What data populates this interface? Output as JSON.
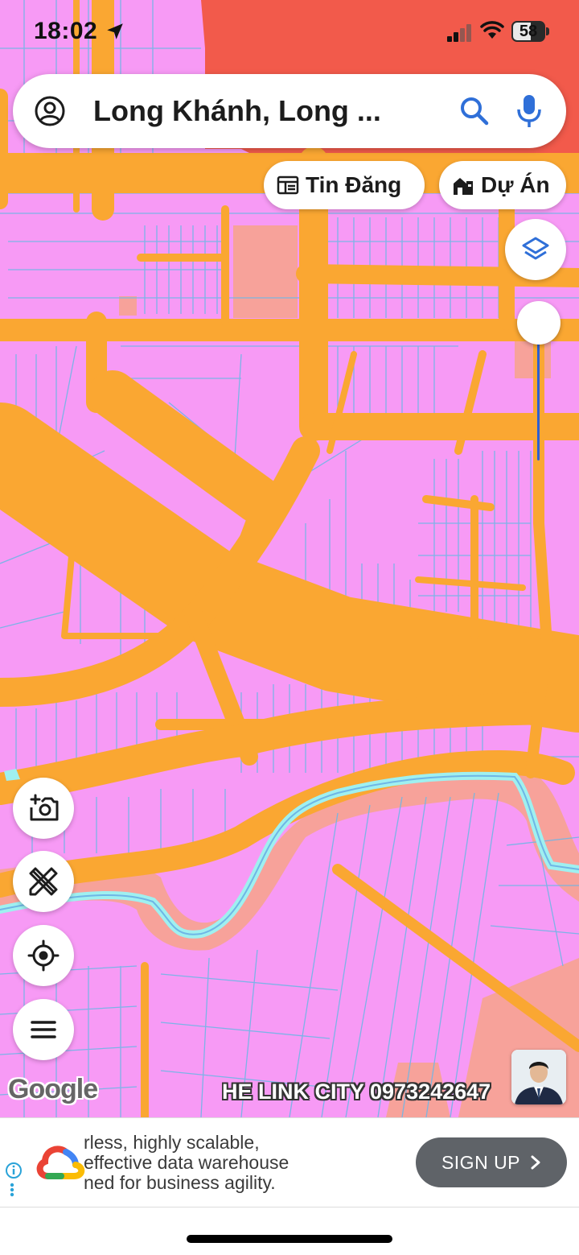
{
  "status_bar": {
    "time": "18:02",
    "battery": "58",
    "battery_level_pct": 58
  },
  "search": {
    "query": "Long Khánh, Long ..."
  },
  "chips": {
    "listings_label": "Tin Đăng",
    "projects_label": "Dự Án"
  },
  "map": {
    "attribution": "Google",
    "marquee": "HE LINK CITY 0973242647",
    "zoom_slider_level": 0.3,
    "colors": {
      "residential": "#f79af5",
      "road": "#faa732",
      "commercial": "#f25a4b",
      "public": "#f7a29a",
      "water": "#9ff0f0",
      "parcel_line": "#6fb6e6"
    }
  },
  "icons": {
    "navigation": "location-arrow-icon",
    "signal": "cellular-signal-icon",
    "wifi": "wifi-icon",
    "battery": "battery-icon",
    "account": "account-circle-icon",
    "search": "search-icon",
    "mic": "microphone-icon",
    "listings": "listings-icon",
    "projects": "projects-icon",
    "layers": "layers-icon",
    "add_photo": "add-photo-icon",
    "measure": "ruler-pencil-icon",
    "locate": "my-location-icon",
    "menu": "menu-icon"
  },
  "ad": {
    "lines": [
      "rless, highly scalable,",
      "effective data warehouse",
      "ned for business agility."
    ],
    "cta": "SIGN UP",
    "cta_color": "#5f6368"
  }
}
